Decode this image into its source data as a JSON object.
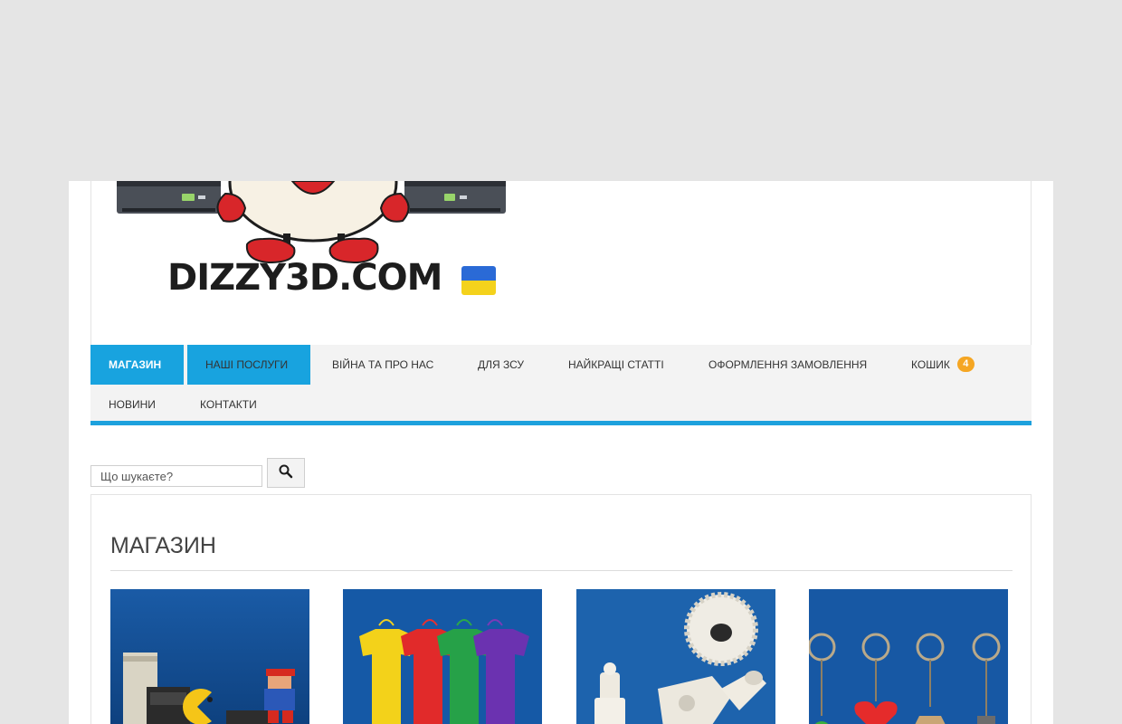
{
  "header": {
    "logo_text": "DIZZY3D.COM"
  },
  "nav": {
    "items": [
      {
        "label": "МАГАЗИН"
      },
      {
        "label": "НАШІ ПОСЛУГИ"
      },
      {
        "label": "ВІЙНА ТА ПРО НАС"
      },
      {
        "label": "ДЛЯ ЗСУ"
      },
      {
        "label": "НАЙКРАЩІ СТАТТІ"
      },
      {
        "label": "ОФОРМЛЕННЯ ЗАМОВЛЕННЯ"
      },
      {
        "label": "КОШИК",
        "badge": "4"
      },
      {
        "label": "НОВИНИ"
      },
      {
        "label": "КОНТАКТИ"
      }
    ]
  },
  "search": {
    "placeholder": "Що шукаєте?"
  },
  "main": {
    "title": "МАГАЗИН"
  },
  "colors": {
    "accent": "#18a3df",
    "badge": "#f5a623",
    "background": "#e5e5e5"
  }
}
